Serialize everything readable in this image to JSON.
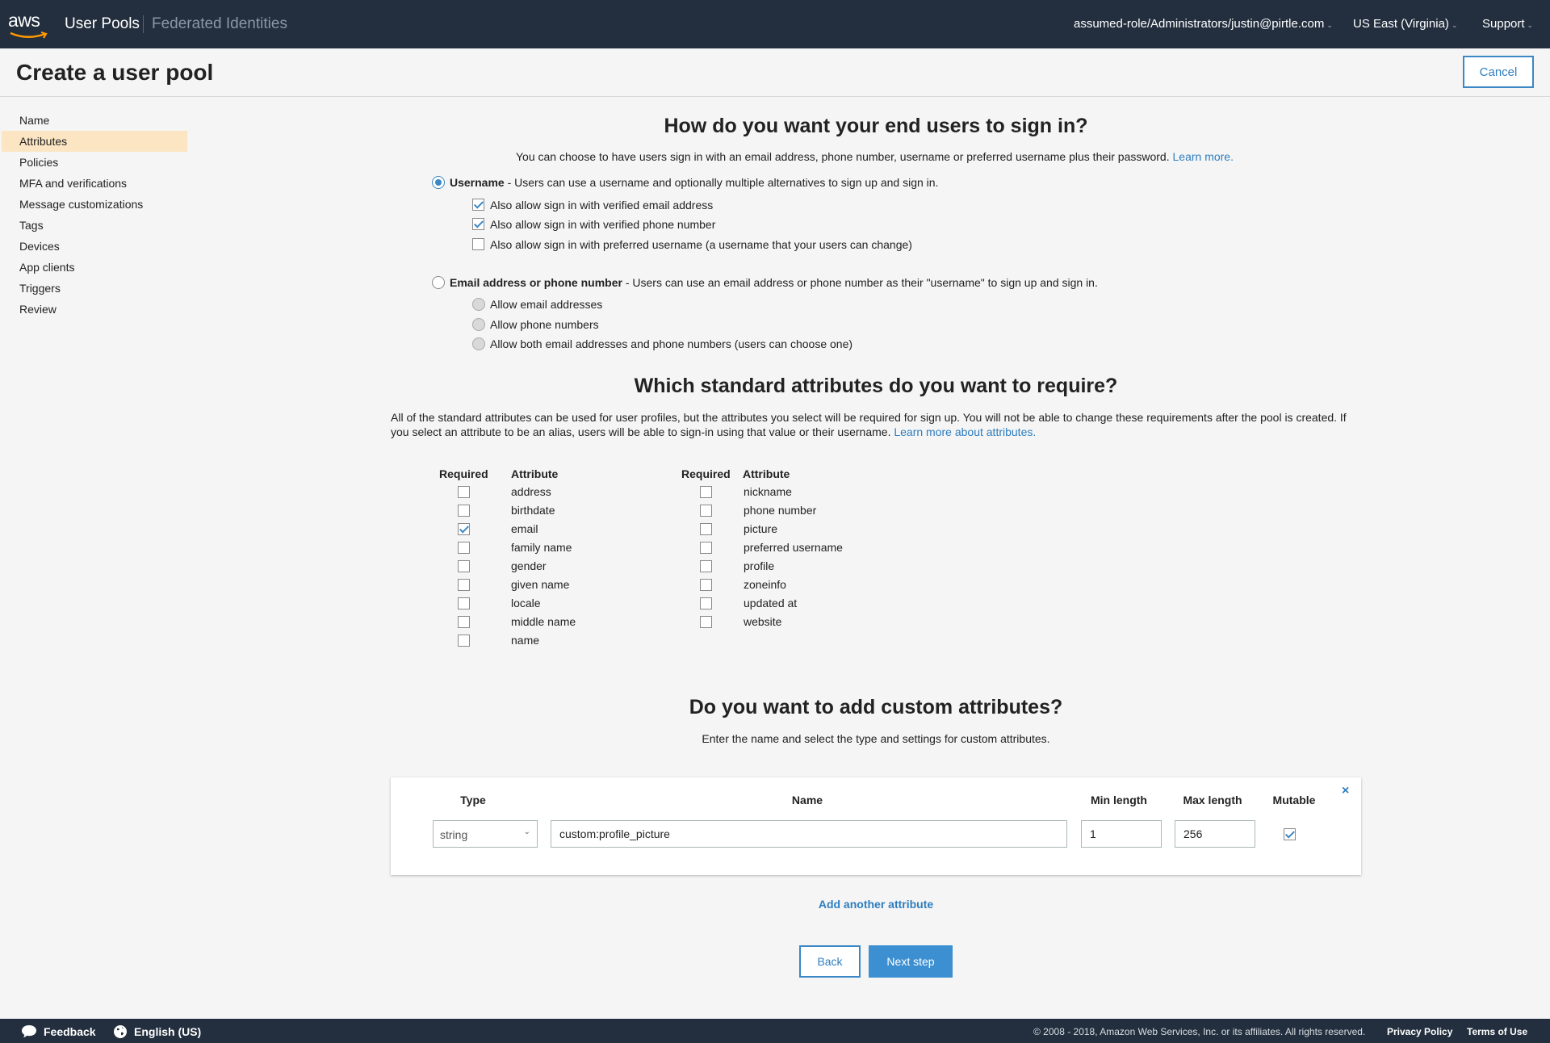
{
  "nav": {
    "logo": "aws",
    "user_pools": "User Pools",
    "federated_identities": "Federated Identities",
    "account": "assumed-role/Administrators/justin@pirtle.com",
    "region": "US East (Virginia)",
    "support": "Support",
    "chevron": "⌄"
  },
  "header": {
    "title": "Create a user pool",
    "cancel": "Cancel"
  },
  "sidebar": {
    "items": [
      {
        "label": "Name"
      },
      {
        "label": "Attributes"
      },
      {
        "label": "Policies"
      },
      {
        "label": "MFA and verifications"
      },
      {
        "label": "Message customizations"
      },
      {
        "label": "Tags"
      },
      {
        "label": "Devices"
      },
      {
        "label": "App clients"
      },
      {
        "label": "Triggers"
      },
      {
        "label": "Review"
      }
    ],
    "active": "Attributes"
  },
  "signin": {
    "title": "How do you want your end users to sign in?",
    "description": "You can choose to have users sign in with an email address, phone number, username or preferred username plus their password.",
    "learn_more": "Learn more.",
    "username_option": {
      "label": "Username",
      "description": " - Users can use a username and optionally multiple alternatives to sign up and sign in.",
      "selected": true,
      "sub_options": [
        {
          "label": "Also allow sign in with verified email address",
          "checked": true
        },
        {
          "label": "Also allow sign in with verified phone number",
          "checked": true
        },
        {
          "label": "Also allow sign in with preferred username (a username that your users can change)",
          "checked": false
        }
      ]
    },
    "email_phone_option": {
      "label": "Email address or phone number",
      "description": " - Users can use an email address or phone number as their \"username\" to sign up and sign in.",
      "selected": false,
      "sub_options": [
        {
          "label": "Allow email addresses"
        },
        {
          "label": "Allow phone numbers"
        },
        {
          "label": "Allow both email addresses and phone numbers (users can choose one)"
        }
      ]
    }
  },
  "standard_attributes": {
    "title": "Which standard attributes do you want to require?",
    "description": "All of the standard attributes can be used for user profiles, but the attributes you select will be required for sign up. You will not be able to change these requirements after the pool is created. If you select an attribute to be an alias, users will be able to sign-in using that value or their username.",
    "learn_more": "Learn more about attributes.",
    "col_required": "Required",
    "col_attribute": "Attribute",
    "left_column": [
      {
        "name": "address",
        "required": false
      },
      {
        "name": "birthdate",
        "required": false
      },
      {
        "name": "email",
        "required": true
      },
      {
        "name": "family name",
        "required": false
      },
      {
        "name": "gender",
        "required": false
      },
      {
        "name": "given name",
        "required": false
      },
      {
        "name": "locale",
        "required": false
      },
      {
        "name": "middle name",
        "required": false
      },
      {
        "name": "name",
        "required": false
      }
    ],
    "right_column": [
      {
        "name": "nickname",
        "required": false
      },
      {
        "name": "phone number",
        "required": false
      },
      {
        "name": "picture",
        "required": false
      },
      {
        "name": "preferred username",
        "required": false
      },
      {
        "name": "profile",
        "required": false
      },
      {
        "name": "zoneinfo",
        "required": false
      },
      {
        "name": "updated at",
        "required": false
      },
      {
        "name": "website",
        "required": false
      }
    ]
  },
  "custom_attributes": {
    "title": "Do you want to add custom attributes?",
    "description": "Enter the name and select the type and settings for custom attributes.",
    "columns": {
      "type": "Type",
      "name": "Name",
      "min_length": "Min length",
      "max_length": "Max length",
      "mutable": "Mutable"
    },
    "row": {
      "type": "string",
      "name": "custom:profile_picture",
      "min_length": "1",
      "max_length": "256",
      "mutable": true
    },
    "remove": "×",
    "add_another": "Add another attribute"
  },
  "actions": {
    "back": "Back",
    "next": "Next step"
  },
  "footer": {
    "feedback": "Feedback",
    "language": "English (US)",
    "copyright": "© 2008 - 2018, Amazon Web Services, Inc. or its affiliates. All rights reserved.",
    "privacy": "Privacy Policy",
    "terms": "Terms of Use"
  },
  "colors": {
    "nav_bg": "#232f3e",
    "accent": "#3c87c5",
    "active_sidebar": "#fbe5c3",
    "primary_button": "#3c8fd0"
  }
}
